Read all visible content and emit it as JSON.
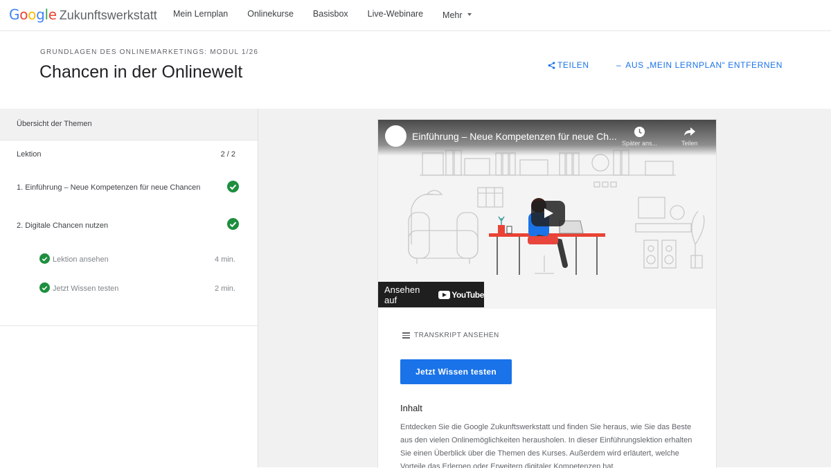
{
  "nav": {
    "logo_google": "Google",
    "logo_name": "Zukunftswerkstatt",
    "items": [
      "Mein Lernplan",
      "Onlinekurse",
      "Basisbox",
      "Live-Webinare",
      "Mehr"
    ]
  },
  "header": {
    "module": "GRUNDLAGEN DES ONLINEMARKETINGS: MODUL 1/26",
    "title": "Chancen in der Onlinewelt",
    "share_label": "TEILEN",
    "remove_label": "AUS „MEIN LERNPLAN“ ENTFERNEN"
  },
  "sidebar": {
    "heading": "Übersicht der Themen",
    "lesson_label": "Lektion",
    "lesson_count": "2 / 2",
    "topics": [
      {
        "label": "1. Einführung – Neue Kompetenzen für neue Chancen",
        "completed": true
      },
      {
        "label": "2. Digitale Chancen nutzen",
        "completed": true
      }
    ],
    "subitems": [
      {
        "label": "Lektion ansehen",
        "duration": "4 min.",
        "completed": true
      },
      {
        "label": "Jetzt Wissen testen",
        "duration": "2 min.",
        "completed": true
      }
    ]
  },
  "video": {
    "title": "Einführung – Neue Kompetenzen für neue Ch...",
    "watch_later": "Später ans...",
    "share": "Teilen",
    "watch_on": "Ansehen auf",
    "youtube": "YouTube"
  },
  "content": {
    "transcript_label": "TRANSKRIPT ANSEHEN",
    "test_button": "Jetzt Wissen testen",
    "heading": "Inhalt",
    "description": "Entdecken Sie die Google Zukunftswerkstatt und finden Sie heraus, wie Sie das Beste aus den vielen Onlinemöglichkeiten herausholen. In dieser Einführungslektion erhalten Sie einen Überblick über die Themen des Kurses. Außerdem wird erläutert, welche Vorteile das Erlernen oder Erweitern digitaler Kompetenzen hat."
  },
  "colors": {
    "accent": "#1a73e8",
    "success": "#1e8e3e",
    "google_blue": "#4285f4",
    "google_red": "#ea4335",
    "google_yellow": "#fbbc05",
    "google_green": "#34a853"
  },
  "icons": [
    "share-icon",
    "check-icon",
    "clock-icon",
    "forward-arrow-icon",
    "youtube-logo-icon",
    "play-icon",
    "transcript-icon",
    "caret-down-icon"
  ]
}
